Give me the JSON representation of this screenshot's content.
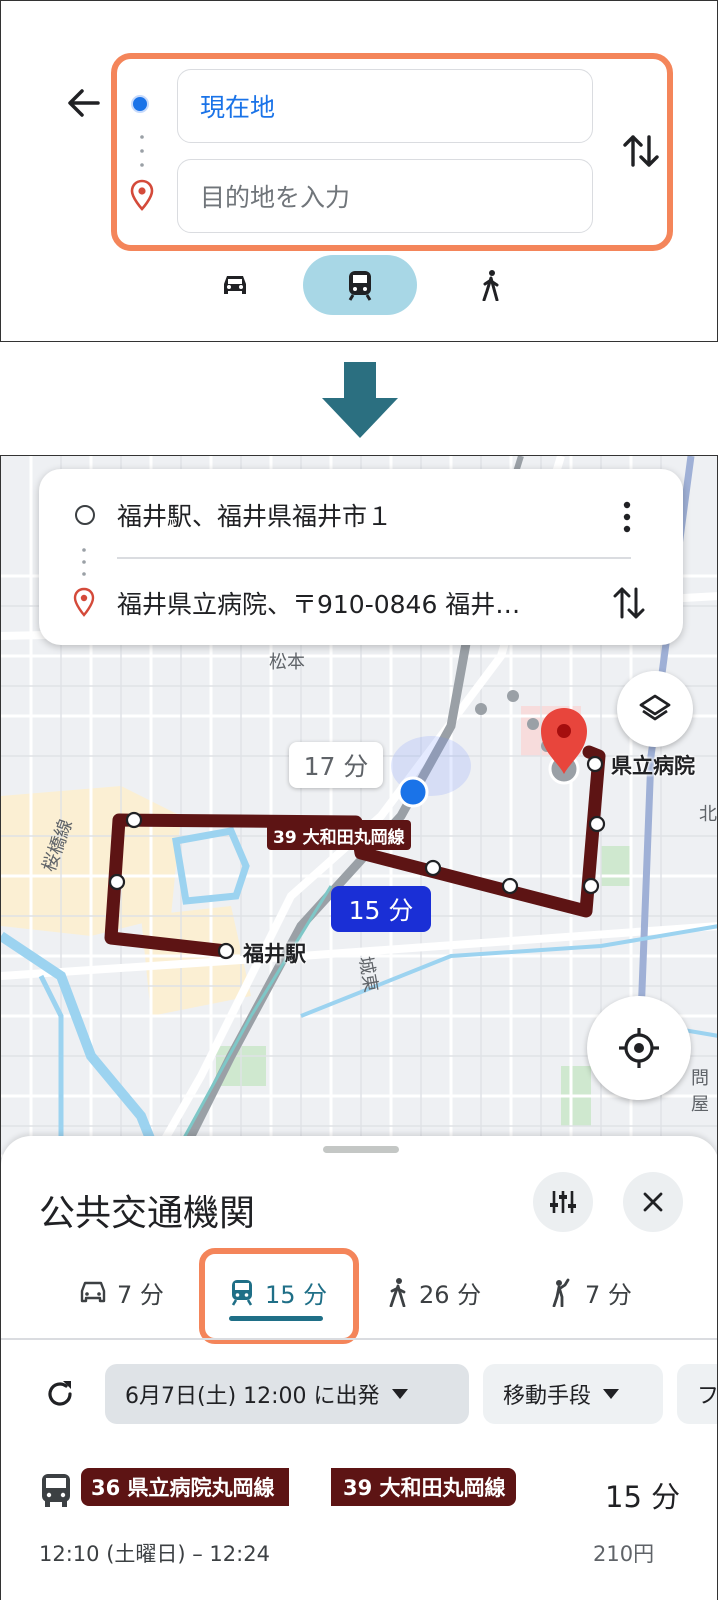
{
  "panel1": {
    "origin_value": "現在地",
    "destination_placeholder": "目的地を入力",
    "modes": [
      "car",
      "transit",
      "walk"
    ],
    "selected_mode": "transit"
  },
  "route_card": {
    "origin": "福井駅、福井県福井市１",
    "destination": "福井県立病院、〒910-0846 福井…"
  },
  "map": {
    "labels": {
      "matsumoto": "松本",
      "sakurabashi": "桜橋線",
      "joto": "城東",
      "kita": "北",
      "tonya": "問屋"
    },
    "stops": {
      "hospital": "県立病院",
      "station": "福井駅"
    },
    "time_bubble_alt": "17 分",
    "time_bubble_selected": "15 分",
    "route_badge": "39 大和田丸岡線"
  },
  "sheet": {
    "title": "公共交通機関",
    "tabs": [
      {
        "icon": "car-icon",
        "label": "7 分"
      },
      {
        "icon": "train-icon",
        "label": "15 分"
      },
      {
        "icon": "walk-icon",
        "label": "26 分"
      },
      {
        "icon": "bike-icon",
        "label": "7 分"
      }
    ],
    "selected_tab": 1,
    "depart_chip": "6月7日(土) 12:00 に出発",
    "mode_chip": "移動手段",
    "more_chip": "フ",
    "itinerary": {
      "routes": [
        "36 県立病院丸岡線",
        "39 大和田丸岡線"
      ],
      "duration": "15 分",
      "time": "12:10 (土曜日) – 12:24",
      "fare": "210円"
    }
  },
  "colors": {
    "accent_blue": "#1a73e8",
    "highlight_orange": "#f4855a",
    "route_maroon": "#5d1414",
    "transit_chip": "#a8d7e6",
    "arrow_teal": "#2b6f80"
  }
}
